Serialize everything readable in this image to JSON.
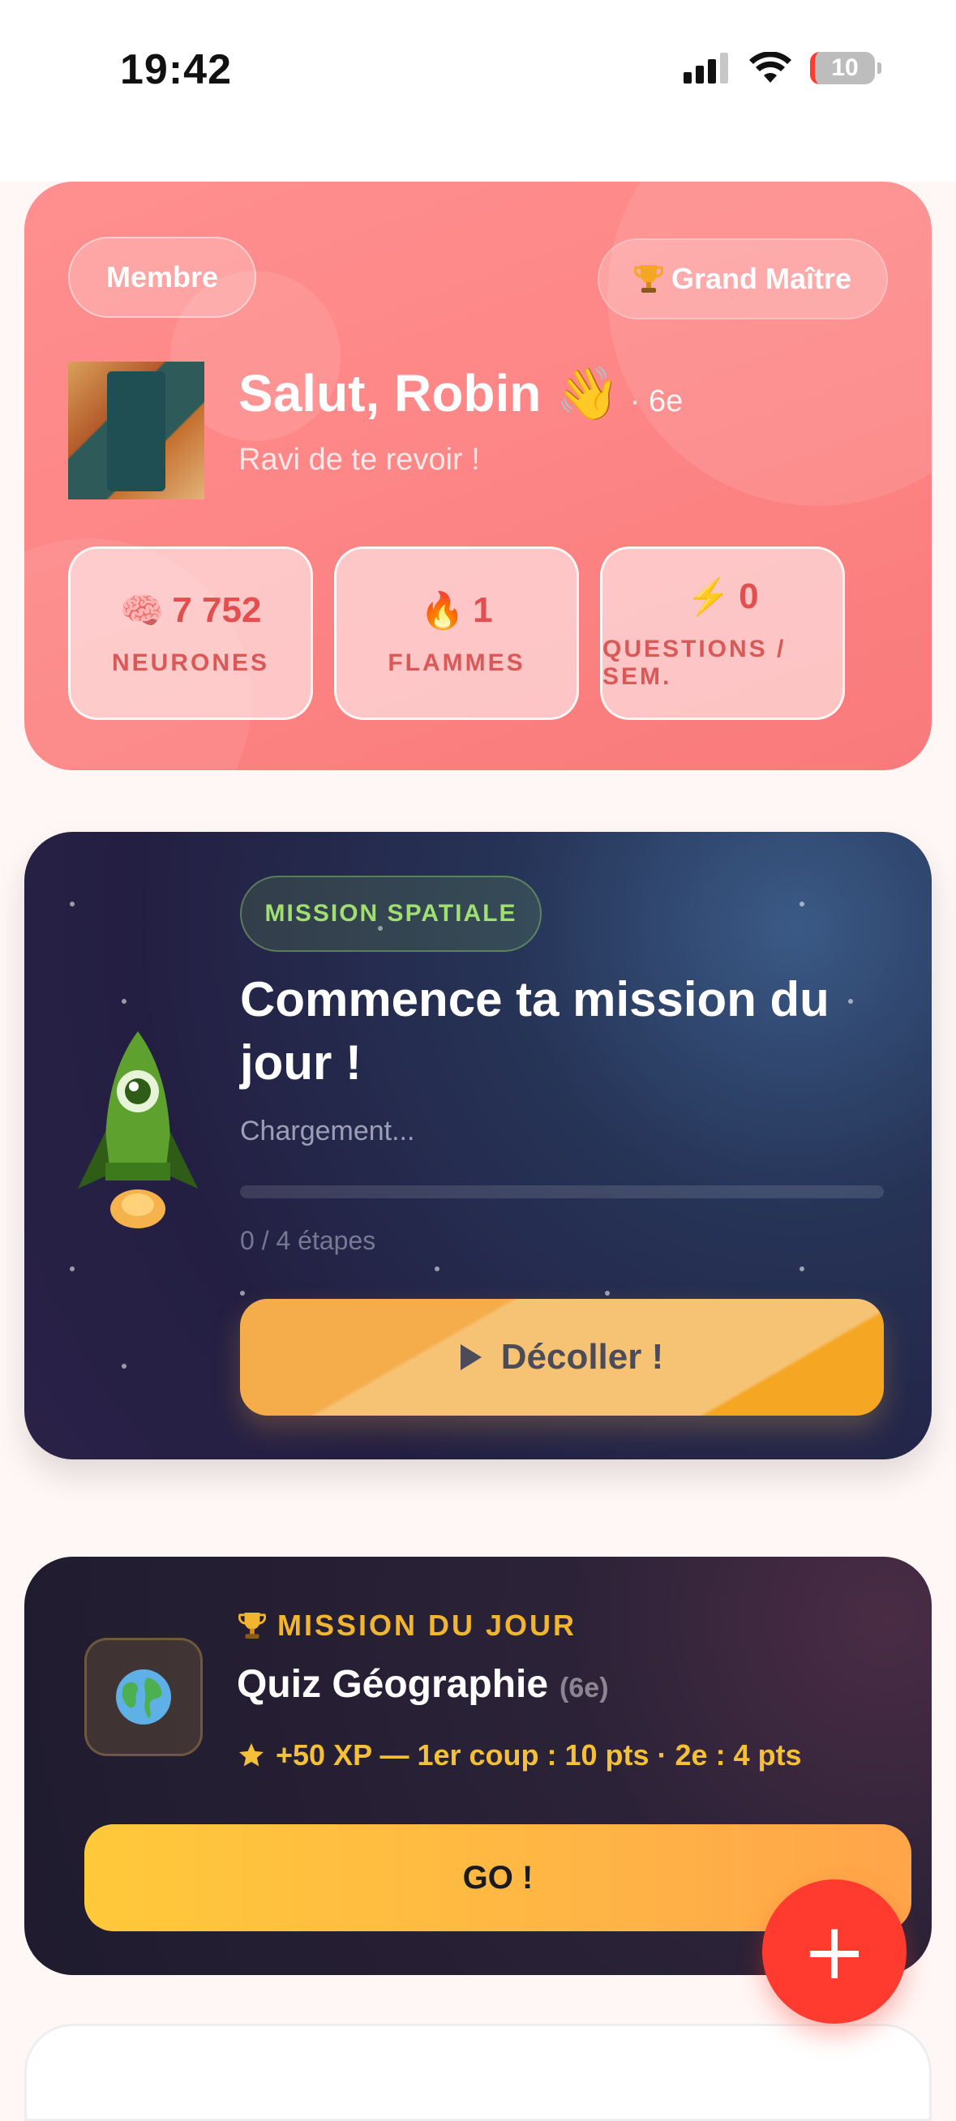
{
  "status_bar": {
    "time": "19:42",
    "battery": "10"
  },
  "profile": {
    "member_badge": "Membre",
    "rank_badge": "Grand Maître",
    "greeting": "Salut, Robin 👋",
    "grade": "· 6e",
    "subtitle": "Ravi de te revoir !",
    "stats": [
      {
        "icon": "🧠",
        "value": "7 752",
        "label": "NEURONES"
      },
      {
        "icon": "🔥",
        "value": "1",
        "label": "FLAMMES"
      },
      {
        "icon": "⚡",
        "value": "0",
        "label": "QUESTIONS / SEM."
      }
    ]
  },
  "space_mission": {
    "badge": "MISSION SPATIALE",
    "title": "Commence ta mission du jour !",
    "loading": "Chargement...",
    "progress": 0,
    "steps": "0 / 4 étapes",
    "button": "Décoller !"
  },
  "daily_mission": {
    "label": "MISSION DU JOUR",
    "title": "Quiz Géographie",
    "grade": "(6e)",
    "reward": "+50 XP — 1er coup : 10 pts · 2e : 4 pts",
    "button": "GO !"
  },
  "fab": {
    "label": "+"
  },
  "colors": {
    "hero": "#fd8585",
    "accent": "#f6b24d",
    "fab": "#ff3b30",
    "daily_accent": "#f2b62e"
  }
}
